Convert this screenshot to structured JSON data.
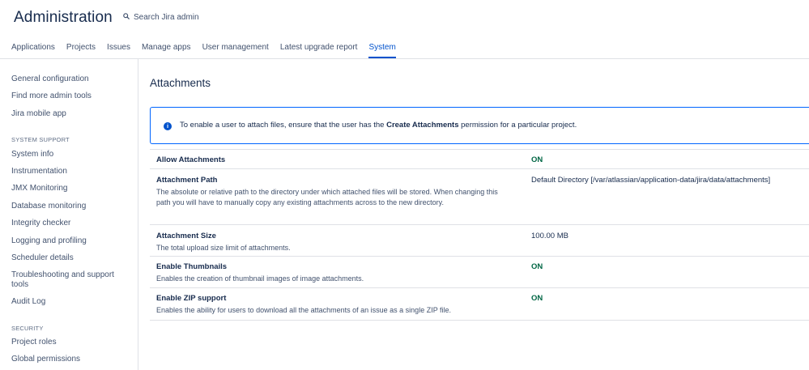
{
  "header": {
    "title": "Administration",
    "search_placeholder": "Search Jira admin",
    "tabs": [
      {
        "label": "Applications"
      },
      {
        "label": "Projects"
      },
      {
        "label": "Issues"
      },
      {
        "label": "Manage apps"
      },
      {
        "label": "User management"
      },
      {
        "label": "Latest upgrade report"
      },
      {
        "label": "System",
        "active": true
      }
    ]
  },
  "sidebar": {
    "items_top": [
      {
        "label": "General configuration"
      },
      {
        "label": "Find more admin tools"
      },
      {
        "label": "Jira mobile app"
      }
    ],
    "system_support": {
      "heading": "SYSTEM SUPPORT",
      "items": [
        {
          "label": "System info"
        },
        {
          "label": "Instrumentation"
        },
        {
          "label": "JMX Monitoring"
        },
        {
          "label": "Database monitoring"
        },
        {
          "label": "Integrity checker"
        },
        {
          "label": "Logging and profiling"
        },
        {
          "label": "Scheduler details"
        },
        {
          "label": "Troubleshooting and support tools"
        },
        {
          "label": "Audit Log"
        }
      ]
    },
    "security": {
      "heading": "SECURITY",
      "items": [
        {
          "label": "Project roles"
        },
        {
          "label": "Global permissions"
        }
      ]
    }
  },
  "main": {
    "title": "Attachments",
    "info": {
      "icon": "info-icon",
      "text_before": "To enable a user to attach files, ensure that the user has the ",
      "text_bold": "Create Attachments",
      "text_after": " permission for a particular project."
    },
    "settings": [
      {
        "name": "Allow Attachments",
        "description": "",
        "value": "ON",
        "is_on": true
      },
      {
        "name": "Attachment Path",
        "description": "The absolute or relative path to the directory under which attached files will be stored. When changing this path you will have to manually copy any existing attachments across to the new directory.",
        "value": "Default Directory [/var/atlassian/application-data/jira/data/attachments]",
        "is_on": false
      },
      {
        "name": "Attachment Size",
        "description": "The total upload size limit of attachments.",
        "value": "100.00 MB",
        "is_on": false
      },
      {
        "name": "Enable Thumbnails",
        "description": "Enables the creation of thumbnail images of image attachments.",
        "value": "ON",
        "is_on": true
      },
      {
        "name": "Enable ZIP support",
        "description": "Enables the ability for users to download all the attachments of an issue as a single ZIP file.",
        "value": "ON",
        "is_on": true
      }
    ]
  },
  "colors": {
    "accent": "#0052cc",
    "on_status": "#006644",
    "border": "#dfe1e6",
    "info_border": "#0065ff"
  }
}
